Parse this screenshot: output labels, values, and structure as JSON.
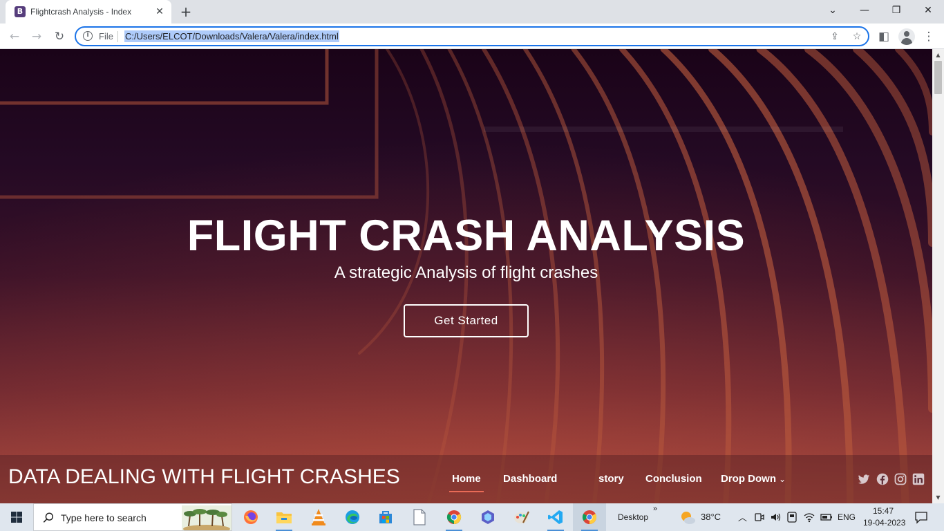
{
  "browser": {
    "tab_title": "Flightcrash Analysis - Index",
    "tab_favicon_letter": "B",
    "url_scheme_label": "File",
    "url": "C:/Users/ELCOT/Downloads/Valera/Valera/index.html"
  },
  "hero": {
    "title": "FLIGHT CRASH ANALYSIS",
    "subtitle": "A strategic Analysis of flight crashes",
    "cta_label": "Get Started"
  },
  "header": {
    "logo": "DATA DEALING WITH FLIGHT CRASHES",
    "nav": {
      "home": "Home",
      "dashboard": "Dashboard",
      "story": "story",
      "conclusion": "Conclusion",
      "dropdown": "Drop Down"
    },
    "social_icons": [
      "twitter-icon",
      "facebook-icon",
      "instagram-icon",
      "linkedin-icon"
    ]
  },
  "taskbar": {
    "search_placeholder": "Type here to search",
    "desktop_label": "Desktop",
    "weather": "38°C",
    "language": "ENG",
    "time": "15:47",
    "date": "19-04-2023",
    "apps": [
      "firefox-icon",
      "file-explorer-icon",
      "vlc-icon",
      "edge-icon",
      "store-icon",
      "notepad-icon",
      "chrome-icon",
      "copilot-icon",
      "paint-icon",
      "vscode-icon",
      "chrome-icon"
    ]
  },
  "colors": {
    "accent_underline": "#e96b56",
    "omnibox_focus": "#1a73e8",
    "url_selection": "#aecbfa",
    "hero_top": "#1a0318",
    "hero_bottom": "#a6483e"
  }
}
